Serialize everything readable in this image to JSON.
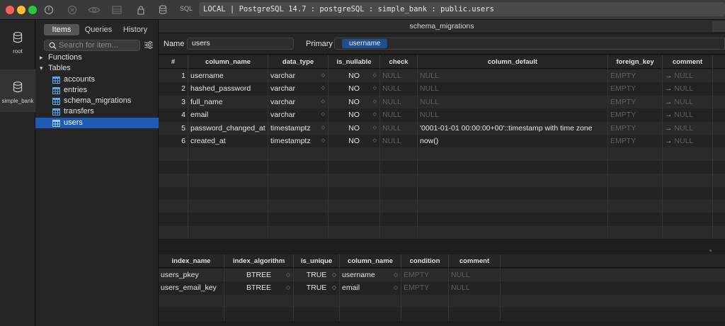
{
  "titlebar": {
    "sql_label": "SQL",
    "connection": "LOCAL | PostgreSQL 14.7 : postgreSQL : simple_bank : public.users",
    "icons": [
      "power-icon",
      "close-circle-icon",
      "eye-icon",
      "layout-icon",
      "lock-icon",
      "database-icon"
    ]
  },
  "rail": [
    {
      "label": "root",
      "icon": "database-icon"
    },
    {
      "label": "simple_bank",
      "icon": "database-icon"
    }
  ],
  "sidebar": {
    "tabs": [
      "Items",
      "Queries",
      "History"
    ],
    "search_placeholder": "Search for item...",
    "groups": [
      {
        "label": "Functions",
        "items": []
      },
      {
        "label": "Tables",
        "items": [
          {
            "label": "accounts",
            "selected": false
          },
          {
            "label": "entries",
            "selected": false
          },
          {
            "label": "schema_migrations",
            "selected": false
          },
          {
            "label": "transfers",
            "selected": false
          },
          {
            "label": "users",
            "selected": true
          }
        ]
      }
    ]
  },
  "main": {
    "tab_title": "schema_migrations",
    "name_label": "Name",
    "name_value": "users",
    "primary_label": "Primary",
    "primary_value": "username",
    "columns": {
      "headers": [
        "#",
        "column_name",
        "data_type",
        "is_nullable",
        "check",
        "column_default",
        "foreign_key",
        "comment"
      ],
      "rows": [
        {
          "n": "1",
          "name": "username",
          "type": "varchar",
          "nullable": "NO",
          "check": "NULL",
          "default": "NULL",
          "fk": "EMPTY",
          "comment": "NULL"
        },
        {
          "n": "2",
          "name": "hashed_password",
          "type": "varchar",
          "nullable": "NO",
          "check": "NULL",
          "default": "NULL",
          "fk": "EMPTY",
          "comment": "NULL"
        },
        {
          "n": "3",
          "name": "full_name",
          "type": "varchar",
          "nullable": "NO",
          "check": "NULL",
          "default": "NULL",
          "fk": "EMPTY",
          "comment": "NULL"
        },
        {
          "n": "4",
          "name": "email",
          "type": "varchar",
          "nullable": "NO",
          "check": "NULL",
          "default": "NULL",
          "fk": "EMPTY",
          "comment": "NULL"
        },
        {
          "n": "5",
          "name": "password_changed_at",
          "type": "timestamptz",
          "nullable": "NO",
          "check": "NULL",
          "default": "'0001-01-01 00:00:00+00'::timestamp with time zone",
          "fk": "EMPTY",
          "comment": "NULL"
        },
        {
          "n": "6",
          "name": "created_at",
          "type": "timestamptz",
          "nullable": "NO",
          "check": "NULL",
          "default": "now()",
          "fk": "EMPTY",
          "comment": "NULL"
        }
      ]
    },
    "indexes": {
      "headers": [
        "index_name",
        "index_algorithm",
        "is_unique",
        "column_name",
        "condition",
        "comment"
      ],
      "rows": [
        {
          "name": "users_pkey",
          "algo": "BTREE",
          "unique": "TRUE",
          "column": "username",
          "condition": "EMPTY",
          "comment": "NULL"
        },
        {
          "name": "users_email_key",
          "algo": "BTREE",
          "unique": "TRUE",
          "column": "email",
          "condition": "EMPTY",
          "comment": "NULL"
        }
      ]
    }
  },
  "colors": {
    "selection": "#1d5bb5",
    "primary_tag": "#1f4f8f",
    "close": "#fe5f57",
    "minimize": "#febc2e",
    "maximize": "#28c840"
  }
}
